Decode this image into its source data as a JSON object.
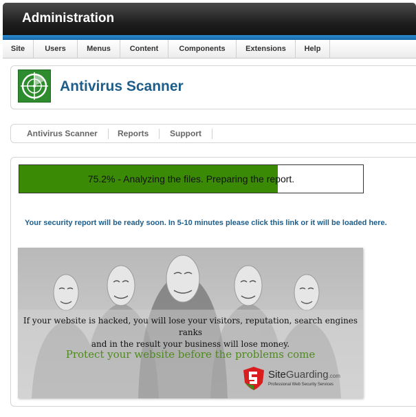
{
  "header": {
    "title": "Administration"
  },
  "menu": [
    {
      "label": "Site"
    },
    {
      "label": "Users"
    },
    {
      "label": "Menus"
    },
    {
      "label": "Content"
    },
    {
      "label": "Components"
    },
    {
      "label": "Extensions"
    },
    {
      "label": "Help"
    }
  ],
  "page": {
    "title": "Antivirus Scanner",
    "icon": "radar-scan-icon"
  },
  "submenu": [
    {
      "label": "Antivirus Scanner"
    },
    {
      "label": "Reports"
    },
    {
      "label": "Support"
    }
  ],
  "progress": {
    "percent": 75.2,
    "text": "75.2% - Analyzing the files. Preparing the report."
  },
  "notice": {
    "before": "Your security report will be ready soon. In 5-10 minutes please click ",
    "link": "this link",
    "after": " or it will be loaded here."
  },
  "banner": {
    "line1": "If your website is hacked, you will lose your visitors, reputation, search engines ranks",
    "line2": "and in the result your business will lose money.",
    "slogan": "Protect your website before the problems come",
    "brand_site": "Site",
    "brand_guarding": "Guarding",
    "brand_tld": ".com",
    "brand_tagline": "Professional Web Security Services"
  },
  "colors": {
    "accent_blue": "#1d5d8a",
    "progress_green": "#3b8a06",
    "logo_green": "#2e8b2e"
  }
}
